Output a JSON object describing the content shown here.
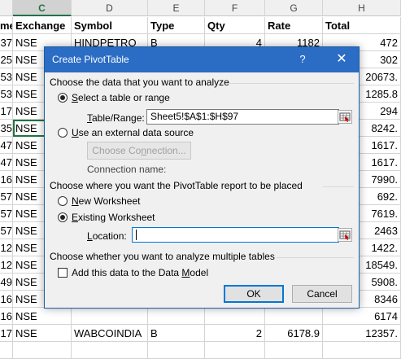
{
  "sheet": {
    "columns": [
      {
        "letter": "C",
        "selected": true
      },
      {
        "letter": "D",
        "selected": false
      },
      {
        "letter": "E",
        "selected": false
      },
      {
        "letter": "F",
        "selected": false
      },
      {
        "letter": "G",
        "selected": false
      },
      {
        "letter": "H",
        "selected": false
      }
    ],
    "header_row": [
      "me",
      "Exchange",
      "Symbol",
      "Type",
      "Qty",
      "Rate",
      "Total"
    ],
    "rows": [
      [
        "37",
        "NSE",
        "HINDPETRO",
        "B",
        "4",
        "1182",
        "472"
      ],
      [
        "25",
        "NSE",
        "",
        "",
        "",
        "",
        "302"
      ],
      [
        "53",
        "NSE",
        "",
        "",
        "",
        "",
        "20673."
      ],
      [
        "53",
        "NSE",
        "",
        "",
        "",
        "",
        "1285.8"
      ],
      [
        "17",
        "NSE",
        "",
        "",
        "",
        "",
        "294"
      ],
      [
        "35",
        "NSE",
        "",
        "",
        "",
        "",
        "8242."
      ],
      [
        "47",
        "NSE",
        "",
        "",
        "",
        "",
        "1617."
      ],
      [
        "47",
        "NSE",
        "",
        "",
        "",
        "",
        "1617."
      ],
      [
        "16",
        "NSE",
        "",
        "",
        "",
        "",
        "7990."
      ],
      [
        "57",
        "NSE",
        "",
        "",
        "",
        "",
        "692."
      ],
      [
        "57",
        "NSE",
        "",
        "",
        "",
        "",
        "7619."
      ],
      [
        "57",
        "NSE",
        "",
        "",
        "",
        "",
        "2463"
      ],
      [
        "12",
        "NSE",
        "",
        "",
        "",
        "",
        "1422."
      ],
      [
        "12",
        "NSE",
        "",
        "",
        "",
        "",
        "18549."
      ],
      [
        "49",
        "NSE",
        "",
        "",
        "",
        "",
        "5908."
      ],
      [
        "16",
        "NSE",
        "",
        "",
        "",
        "",
        "8346"
      ],
      [
        "16",
        "NSE",
        "",
        "",
        "",
        "",
        "6174"
      ],
      [
        "17",
        "NSE",
        "WABCOINDIA",
        "B",
        "2",
        "6178.9",
        "12357."
      ],
      [
        "",
        "",
        "",
        "",
        "",
        "",
        ""
      ]
    ]
  },
  "dialog": {
    "title": "Create PivotTable",
    "help_icon": "?",
    "close_icon": "✕",
    "section1": "Choose the data that you want to analyze",
    "opt_select_prefix": "",
    "opt_select_u": "S",
    "opt_select_rest": "elect a table or range",
    "table_range_u": "T",
    "table_range_rest": "able/Range:",
    "table_range_value": "Sheet5!$A$1:$H$97",
    "opt_external_u": "U",
    "opt_external_rest": "se an external data source",
    "choose_conn_pre": "Choose Co",
    "choose_conn_u": "n",
    "choose_conn_rest": "nection...",
    "connection_name": "Connection name:",
    "section2": "Choose where you want the PivotTable report to be placed",
    "opt_new_u": "N",
    "opt_new_rest": "ew Worksheet",
    "opt_existing_u": "E",
    "opt_existing_rest": "xisting Worksheet",
    "location_u": "L",
    "location_rest": "ocation:",
    "location_value": "",
    "section3": "Choose whether you want to analyze multiple tables",
    "add_model_label": "Add this data to the Data ",
    "add_model_u": "M",
    "add_model_rest": "odel",
    "ok": "OK",
    "cancel": "Cancel"
  }
}
